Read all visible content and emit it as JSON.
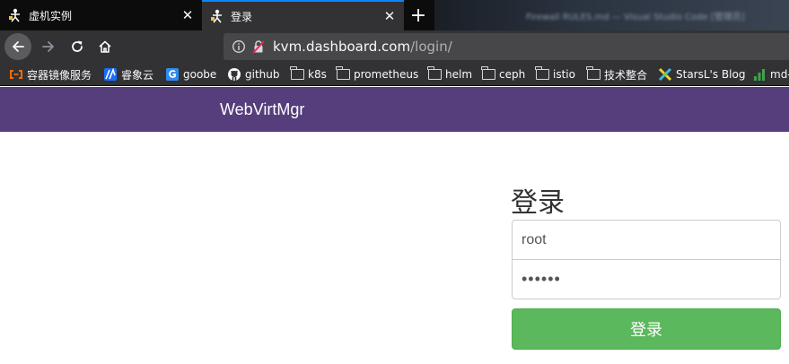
{
  "tabs": [
    {
      "title": "虚机实例",
      "close": "✕"
    },
    {
      "title": "登录",
      "close": "✕"
    }
  ],
  "new_tab": "+",
  "background_tabs_blurred": "Firewall RULES.md — Visual Studio Code [管理员]",
  "address_bar": {
    "url_host": "kvm.dashboard.com",
    "url_path": "/login/"
  },
  "bookmarks": [
    {
      "label": "容器镜像服务",
      "icon": "aliyun-icon"
    },
    {
      "label": "睿象云",
      "icon": "ruixiang-icon"
    },
    {
      "label": "goobe",
      "icon": "goobe-icon"
    },
    {
      "label": "github",
      "icon": "github-icon"
    },
    {
      "label": "k8s",
      "icon": "folder-icon"
    },
    {
      "label": "prometheus",
      "icon": "folder-icon"
    },
    {
      "label": "helm",
      "icon": "folder-icon"
    },
    {
      "label": "ceph",
      "icon": "folder-icon"
    },
    {
      "label": "istio",
      "icon": "folder-icon"
    },
    {
      "label": "技术整合",
      "icon": "folder-icon"
    },
    {
      "label": "StarsL's Blog",
      "icon": "starsl-icon"
    },
    {
      "label": "md-",
      "icon": "bar-chart-icon"
    }
  ],
  "page": {
    "brand": "WebVirtMgr",
    "login_title": "登录",
    "username_value": "root",
    "password_value": "••••••",
    "submit_label": "登录"
  },
  "colors": {
    "header_purple": "#563d7c",
    "submit_green": "#5cb85c",
    "active_tab_accent": "#0a84ff",
    "browser_chrome": "#323234"
  }
}
